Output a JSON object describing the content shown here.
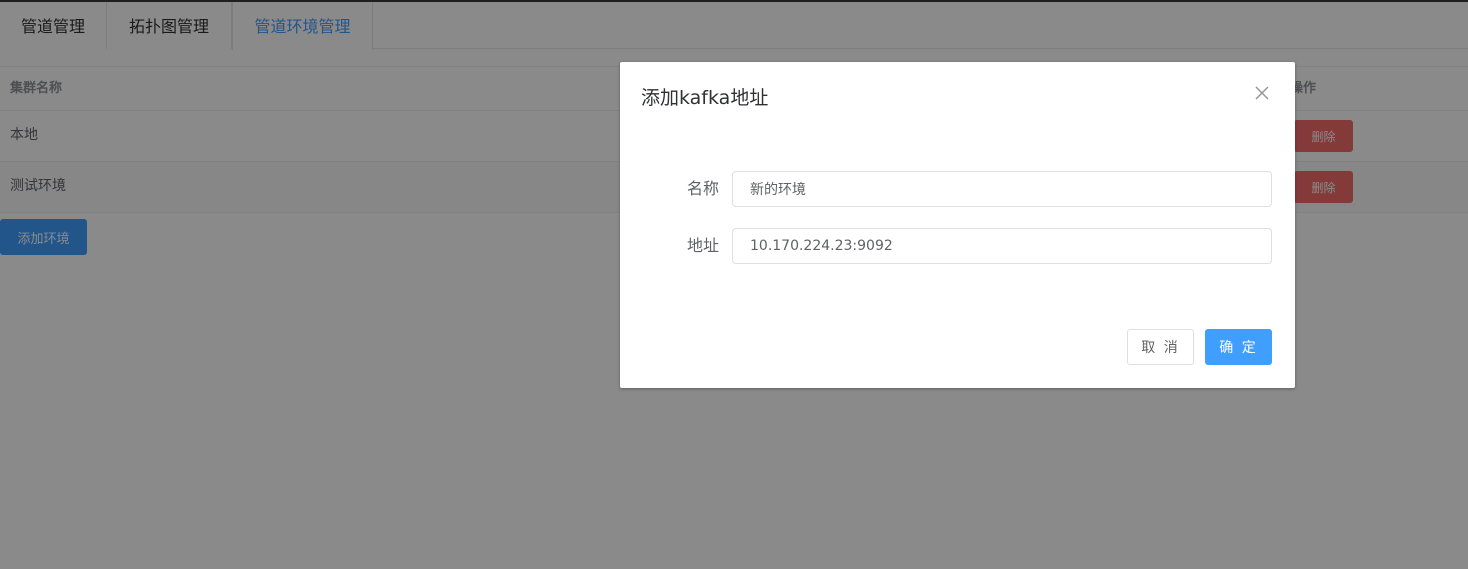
{
  "tabs": [
    {
      "label": "管道管理"
    },
    {
      "label": "拓扑图管理"
    },
    {
      "label": "管道环境管理",
      "active": true
    }
  ],
  "table": {
    "columns": {
      "name": "集群名称",
      "operation": "操作"
    },
    "rows": [
      {
        "name": "本地",
        "delete_label": "删除"
      },
      {
        "name": "测试环境",
        "delete_label": "删除"
      }
    ]
  },
  "add_env_label": "添加环境",
  "dialog": {
    "title": "添加kafka地址",
    "close_icon": "close-icon",
    "fields": [
      {
        "label": "名称",
        "value": "新的环境"
      },
      {
        "label": "地址",
        "value": "10.170.224.23:9092"
      }
    ],
    "cancel_label": "取 消",
    "confirm_label": "确 定"
  },
  "colors": {
    "primary": "#409eff",
    "danger": "#f56c6c",
    "mask": "rgba(0,0,0,0.46)"
  }
}
